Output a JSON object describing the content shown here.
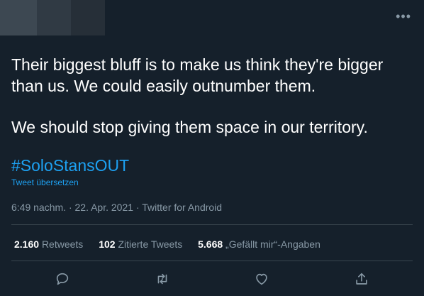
{
  "tweet": {
    "paragraphs": [
      "Their biggest bluff is to make us think they're bigger than us. We could easily outnumber them.",
      "We should stop giving them space in our territory."
    ],
    "hashtag": "#SoloStansOUT",
    "translate_label": "Tweet übersetzen",
    "time": "6:49 nachm.",
    "separator": "·",
    "date": "22. Apr. 2021",
    "source": "Twitter for Android"
  },
  "stats": {
    "retweets_count": "2.160",
    "retweets_label": "Retweets",
    "quotes_count": "102",
    "quotes_label": "Zitierte Tweets",
    "likes_count": "5.668",
    "likes_label": "„Gefällt mir“-Angaben"
  },
  "icons": {
    "more": "more-icon",
    "reply": "reply-icon",
    "retweet": "retweet-icon",
    "like": "heart-icon",
    "share": "share-icon"
  },
  "colors": {
    "background": "#15202b",
    "text": "#ffffff",
    "muted": "#8899a6",
    "accent": "#1da1f2",
    "divider": "#38444d"
  }
}
